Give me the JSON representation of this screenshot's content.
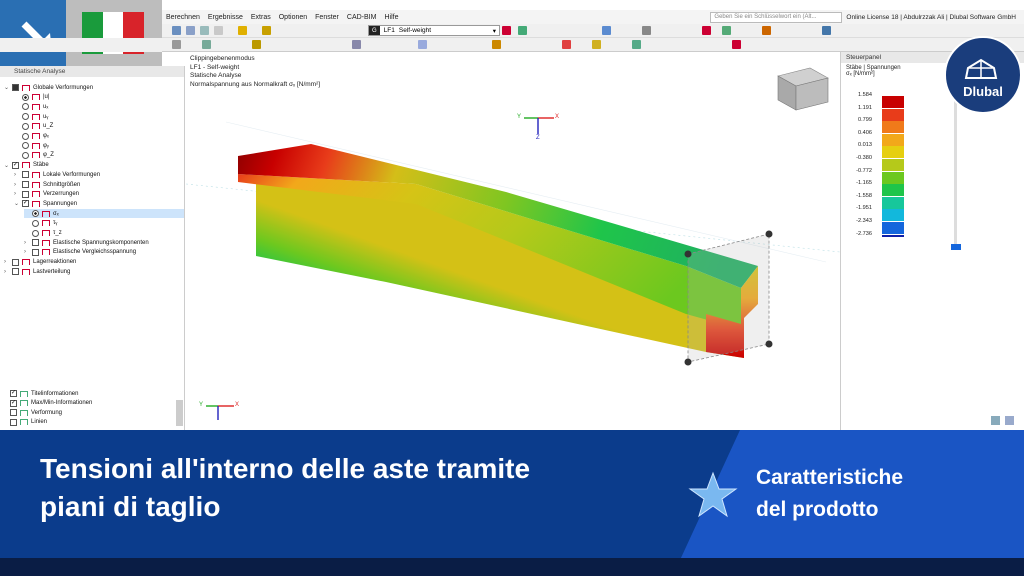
{
  "menu": [
    "Berechnen",
    "Ergebnisse",
    "Extras",
    "Optionen",
    "Fenster",
    "CAD-BIM",
    "Hilfe"
  ],
  "search": {
    "placeholder": "Geben Sie ein Schlüsselwort ein (Alt..."
  },
  "license": "Online License 18 | Abdulrzzak Ali | Dlubal Software GmbH",
  "load_case": {
    "tag": "G",
    "id": "LF1",
    "name": "Self-weight"
  },
  "navigator": {
    "title": "Statische Analyse",
    "items": [
      {
        "label": "Globale Verformungen",
        "level": 0,
        "check": "partial",
        "expand": "open"
      },
      {
        "label": "|u|",
        "level": 1,
        "radio": true,
        "selected": true
      },
      {
        "label": "uₓ",
        "level": 1,
        "radio": true
      },
      {
        "label": "uᵧ",
        "level": 1,
        "radio": true
      },
      {
        "label": "u_Z",
        "level": 1,
        "radio": true
      },
      {
        "label": "φₓ",
        "level": 1,
        "radio": true
      },
      {
        "label": "φᵧ",
        "level": 1,
        "radio": true
      },
      {
        "label": "φ_Z",
        "level": 1,
        "radio": true
      },
      {
        "label": "Stäbe",
        "level": 0,
        "check": "on",
        "expand": "open"
      },
      {
        "label": "Lokale Verformungen",
        "level": 1,
        "check": "off",
        "expand": "closed"
      },
      {
        "label": "Schnittgrößen",
        "level": 1,
        "check": "off",
        "expand": "closed"
      },
      {
        "label": "Verzerrungen",
        "level": 1,
        "check": "off",
        "expand": "closed"
      },
      {
        "label": "Spannungen",
        "level": 1,
        "check": "on",
        "expand": "open"
      },
      {
        "label": "σₓ",
        "level": 2,
        "radio": true,
        "selected": true,
        "highlight": true
      },
      {
        "label": "τᵧ",
        "level": 2,
        "radio": true
      },
      {
        "label": "τ_z",
        "level": 2,
        "radio": true
      },
      {
        "label": "Elastische Spannungskomponenten",
        "level": 2,
        "check": "off",
        "expand": "closed"
      },
      {
        "label": "Elastische Vergleichsspannung",
        "level": 2,
        "check": "off",
        "expand": "closed"
      },
      {
        "label": "Lagerreaktionen",
        "level": 0,
        "check": "off",
        "expand": "closed"
      },
      {
        "label": "Lastverteilung",
        "level": 0,
        "check": "off",
        "expand": "closed"
      }
    ],
    "bottom_items": [
      {
        "label": "Titelinformationen",
        "check": "on"
      },
      {
        "label": "Max/Min-Informationen",
        "check": "on"
      },
      {
        "label": "Verformung",
        "check": "off"
      },
      {
        "label": "Linien",
        "check": "off"
      }
    ]
  },
  "viewport": {
    "info": [
      "Clippingebenenmodus",
      "LF1 - Self-weight",
      "Statische Analyse",
      "Normalspannung aus Normalkraft σₓ [N/mm²]"
    ],
    "axes": {
      "x": "X",
      "y": "Y",
      "z": "Z"
    }
  },
  "panel": {
    "title": "Steuerpanel",
    "subtitle": "Stäbe | Spannungen",
    "unit": "σₓ [N/mm²]",
    "legend": [
      {
        "value": "1.584",
        "color": "#c80000"
      },
      {
        "value": "1.191",
        "color": "#e83c1a"
      },
      {
        "value": "0.799",
        "color": "#f07a1a"
      },
      {
        "value": "0.406",
        "color": "#f2a81a"
      },
      {
        "value": "0.013",
        "color": "#e6cf10"
      },
      {
        "value": "-0.380",
        "color": "#b5c91a"
      },
      {
        "value": "-0.772",
        "color": "#6cc81f"
      },
      {
        "value": "-1.165",
        "color": "#1fc54a"
      },
      {
        "value": "-1.558",
        "color": "#17c79b"
      },
      {
        "value": "-1.951",
        "color": "#12b8dc"
      },
      {
        "value": "-2.343",
        "color": "#1466dc"
      },
      {
        "value": "-2.736",
        "color": "#0e1ea8"
      }
    ]
  },
  "logo": "Dlubal",
  "banner": {
    "headline": [
      "Tensioni all'interno delle aste tramite",
      "piani di taglio"
    ],
    "feature": [
      "Caratteristiche",
      "del prodotto"
    ]
  },
  "colors": {
    "banner": "#0b3c8c",
    "banner_accent": "#1a55c4",
    "arrow_box": "#2a6fb3",
    "flag_green": "#1a9b3c",
    "flag_red": "#d8232a"
  }
}
